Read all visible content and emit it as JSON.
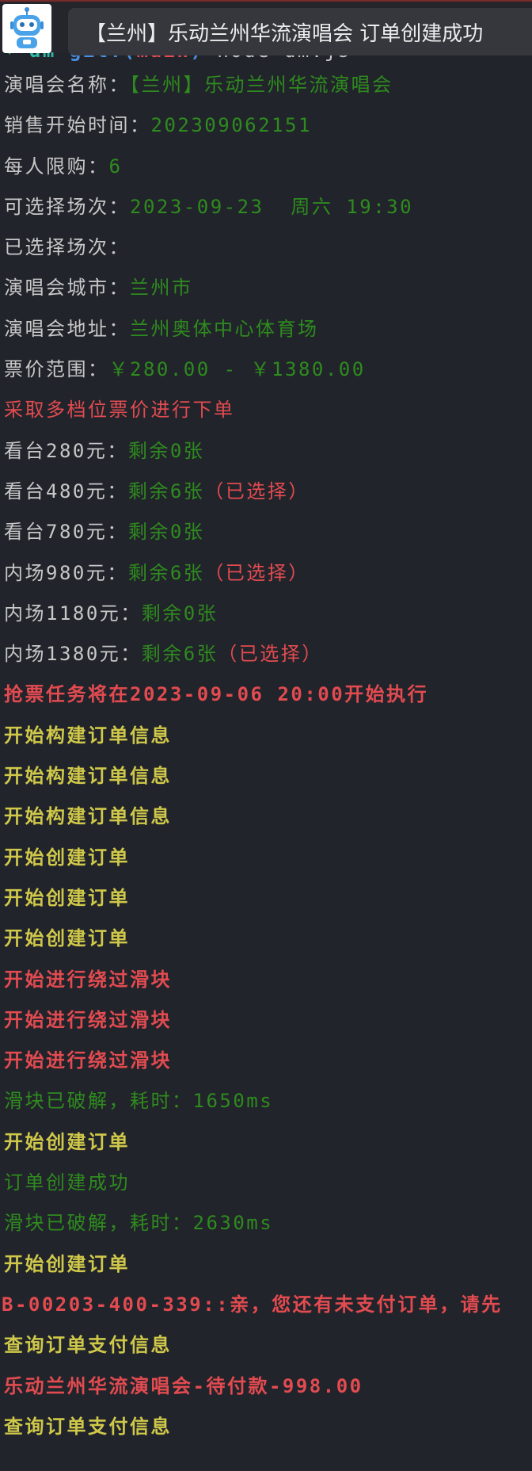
{
  "notification": {
    "text": "【兰州】乐动兰州华流演唱会 订单创建成功",
    "icon": "robot-icon"
  },
  "prompt": {
    "arrow": "➜",
    "dir": "dm",
    "git_prefix": "git:(",
    "branch": "main",
    "git_suffix": ")",
    "command": "node dm.js"
  },
  "info": {
    "name_label": "演唱会名称：",
    "name_value": "【兰州】乐动兰州华流演唱会",
    "sale_time_label": "销售开始时间：",
    "sale_time_value": "202309062151",
    "limit_label": "每人限购：",
    "limit_value": "6",
    "sessions_label": "可选择场次：",
    "sessions_value": "2023-09-23  周六 19:30",
    "selected_label": "已选择场次：",
    "city_label": "演唱会城市：",
    "city_value": "兰州市",
    "address_label": "演唱会地址：",
    "address_value": "兰州奥体中心体育场",
    "price_label": "票价范围：",
    "price_value": "￥280.00 - ￥1380.00",
    "strategy": "采取多档位票价进行下单"
  },
  "tickets": [
    {
      "label": "看台280元：",
      "remain": "剩余0张",
      "selected": ""
    },
    {
      "label": "看台480元：",
      "remain": "剩余6张",
      "selected": "（已选择）"
    },
    {
      "label": "看台780元：",
      "remain": "剩余0张",
      "selected": ""
    },
    {
      "label": "内场980元：",
      "remain": "剩余6张",
      "selected": "（已选择）"
    },
    {
      "label": "内场1180元：",
      "remain": "剩余0张",
      "selected": ""
    },
    {
      "label": "内场1380元：",
      "remain": "剩余6张",
      "selected": "（已选择）"
    }
  ],
  "log": {
    "task_schedule": "抢票任务将在2023-09-06 20:00开始执行",
    "build_1": "开始构建订单信息",
    "build_2": "开始构建订单信息",
    "build_3": "开始构建订单信息",
    "create_1": "开始创建订单",
    "create_2": "开始创建订单",
    "create_3": "开始创建订单",
    "slider_1": "开始进行绕过滑块",
    "slider_2": "开始进行绕过滑块",
    "slider_3": "开始进行绕过滑块",
    "cracked_1": "滑块已破解，耗时：1650ms",
    "create_4": "开始创建订单",
    "success": "订单创建成功",
    "cracked_2": "滑块已破解，耗时：2630ms",
    "create_5": "开始创建订单",
    "error": "B-00203-400-339::亲，您还有未支付订单，请先",
    "query_1": "查询订单支付信息",
    "pending": "乐动兰州华流演唱会-待付款-998.00",
    "query_2": "查询订单支付信息"
  },
  "colors": {
    "background": "#22242b",
    "green": "#2e8b1e",
    "red": "#e24b50",
    "yellow": "#cfc84a"
  }
}
